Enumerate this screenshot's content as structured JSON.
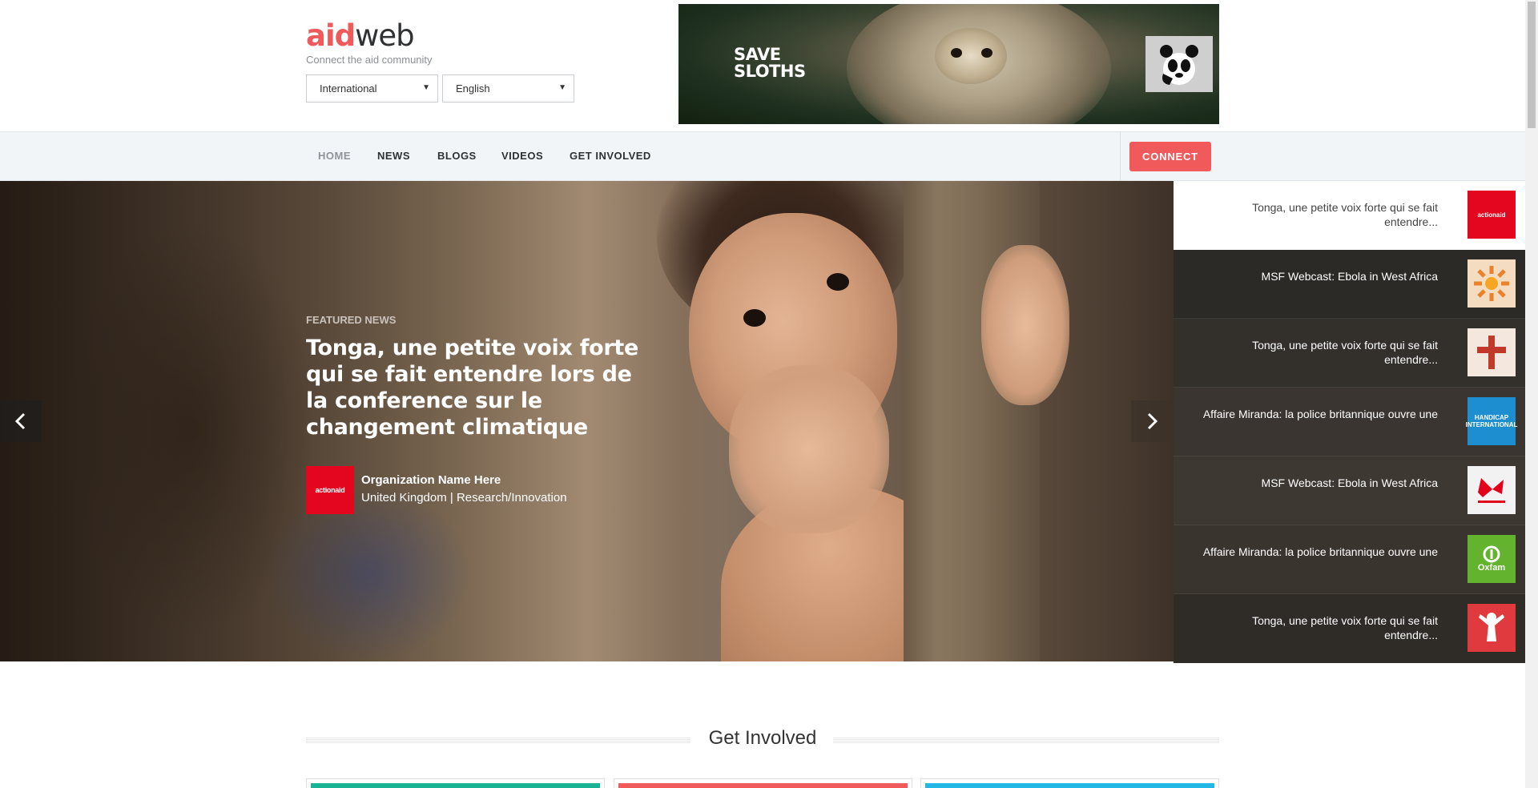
{
  "header": {
    "logo_accent": "aid",
    "logo_rest": "web",
    "tagline": "Connect the aid community",
    "region_select": "International",
    "language_select": "English"
  },
  "banner": {
    "headline_1": "SAVE",
    "headline_2": "SLOTHS",
    "logo_icon": "panda-logo-icon"
  },
  "nav": {
    "items": [
      "HOME",
      "NEWS",
      "BLOGS",
      "VIDEOS",
      "GET INVOLVED"
    ],
    "active": "HOME",
    "connect": "CONNECT"
  },
  "hero": {
    "label": "FEATURED NEWS",
    "title": "Tonga, une petite voix forte qui se fait entendre lors de la conference sur le changement climatique",
    "org_logo": "actionaid",
    "org_name": "Organization Name Here",
    "org_meta": "United Kingdom | Research/Innovation",
    "prev_icon": "chevron-left-icon",
    "next_icon": "chevron-right-icon"
  },
  "side_list": [
    {
      "text": "Tonga, une petite voix forte qui se fait entendre...",
      "logo": "actionaid",
      "color": "#e4061f"
    },
    {
      "text": "MSF Webcast: Ebola in West Africa",
      "logo": "",
      "color": "#f3dcbf"
    },
    {
      "text": "Tonga, une petite voix forte qui se fait entendre...",
      "logo": "",
      "color": "#f4e7de"
    },
    {
      "text": "Affaire Miranda: la police britannique ouvre une",
      "logo": "HANDICAP INTERNATIONAL",
      "color": "#1d8fd0"
    },
    {
      "text": "MSF Webcast: Ebola in West Africa",
      "logo": "",
      "color": "#f2f2f2"
    },
    {
      "text": "Affaire Miranda: la police britannique ouvre une",
      "logo": "Oxfam",
      "color": "#64b32e"
    },
    {
      "text": "Tonga, une petite voix forte qui se fait entendre...",
      "logo": "",
      "color": "#e03a3e"
    }
  ],
  "get_involved": {
    "title": "Get Involved",
    "card_colors": [
      "#1ab394",
      "#f05a5b",
      "#23b7e5"
    ]
  }
}
